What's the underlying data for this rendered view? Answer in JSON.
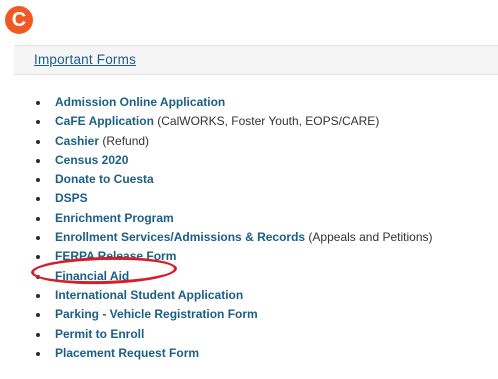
{
  "badge": {
    "letter": "C",
    "color": "#ef5a24"
  },
  "section": {
    "title": "Important Forms"
  },
  "forms": [
    {
      "label": "Admission Online Application",
      "note": ""
    },
    {
      "label": "CaFE Application",
      "note": " (CalWORKS, Foster Youth, EOPS/CARE)"
    },
    {
      "label": "Cashier",
      "note": " (Refund)"
    },
    {
      "label": "Census 2020",
      "note": ""
    },
    {
      "label": "Donate to Cuesta",
      "note": ""
    },
    {
      "label": "DSPS",
      "note": ""
    },
    {
      "label": "Enrichment Program",
      "note": ""
    },
    {
      "label": "Enrollment Services/Admissions & Records",
      "note": " (Appeals and Petitions)"
    },
    {
      "label": "FERPA Release Form",
      "note": ""
    },
    {
      "label": "Financial Aid",
      "note": ""
    },
    {
      "label": "International Student Application",
      "note": ""
    },
    {
      "label": "Parking - Vehicle Registration Form",
      "note": ""
    },
    {
      "label": "Permit to Enroll",
      "note": ""
    },
    {
      "label": "Placement Request Form",
      "note": ""
    }
  ],
  "highlight": {
    "target": "FERPA Release Form",
    "color": "#d81d2a"
  },
  "colors": {
    "link": "#1b5f86",
    "header_bg": "#f5f5f5"
  }
}
